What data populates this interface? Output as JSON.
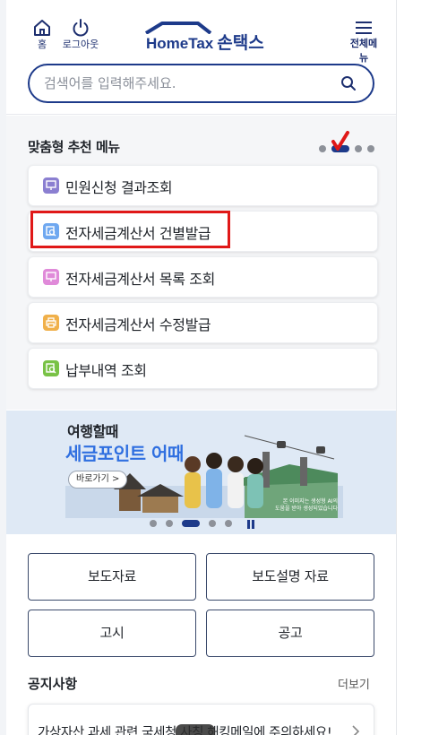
{
  "header": {
    "home_label": "홈",
    "logout_label": "로그아웃",
    "logo_en": "HomeTax",
    "logo_ko": "손택스",
    "menu_label": "전체메뉴",
    "search_placeholder": "검색어를 입력해주세요."
  },
  "recommended": {
    "title": "맞춤형 추천 메뉴",
    "items": [
      {
        "label": "민원신청 결과조회",
        "icon": "monitor-icon",
        "color": "#8b7fd1"
      },
      {
        "label": "전자세금계산서 건별발급",
        "icon": "search-doc-icon",
        "color": "#6fa8f0",
        "highlighted": true
      },
      {
        "label": "전자세금계산서 목록 조회",
        "icon": "monitor-icon",
        "color": "#e08ad9"
      },
      {
        "label": "전자세금계산서 수정발급",
        "icon": "printer-icon",
        "color": "#f0b04a"
      },
      {
        "label": "납부내역 조회",
        "icon": "search-doc-icon",
        "color": "#79c246"
      }
    ],
    "page_indicator_active": 2,
    "page_indicator_count": 5
  },
  "banner": {
    "title_line1": "여행할때",
    "title_line2": "세금포인트 어때",
    "go_label": "바로가기 >",
    "caption_line1": "본 이미지는 생성형 AI의",
    "caption_line2": "도움을 받아 생성되었습니다",
    "page_indicator_active": 3,
    "page_indicator_count": 5
  },
  "quick_links": {
    "press_release": "보도자료",
    "press_explanation": "보도설명 자료",
    "notice_gosi": "고시",
    "announcement": "공고"
  },
  "notices": {
    "title": "공지사항",
    "more_label": "더보기",
    "first_item": "가상자산 과세 관련 국세청 사칭 해킹메일에 주의하세요!"
  },
  "colors": {
    "brand": "#1d3a8a",
    "accent": "#2f6fe0",
    "highlight_box": "#e01818"
  }
}
